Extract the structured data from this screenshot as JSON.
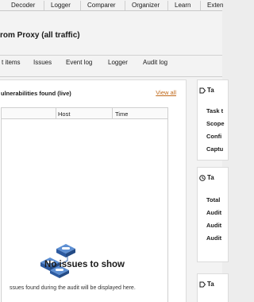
{
  "top_tabs": [
    "Decoder",
    "Logger",
    "Comparer",
    "Organizer",
    "Learn",
    "Exten"
  ],
  "task_title": "rom Proxy (all traffic)",
  "sub_tabs": [
    "t items",
    "Issues",
    "Event log",
    "Logger",
    "Audit log"
  ],
  "panel": {
    "title": "ulnerabilities found (live)",
    "view_all": "View all",
    "columns": [
      "",
      "Host",
      "Time"
    ],
    "empty_title": "No issues to show",
    "empty_desc": "ssues found during the audit will be displayed here."
  },
  "side": {
    "card1": {
      "heading": "Ta",
      "icon": "tag-icon",
      "rows": [
        "Task t",
        "Scope",
        "Confi",
        "Captu"
      ]
    },
    "card2": {
      "heading": "Ta",
      "icon": "clock-icon",
      "rows": [
        "Total",
        "Audit",
        "Audit",
        "Audit"
      ]
    },
    "card3": {
      "heading": "Ta",
      "icon": "tag-icon"
    }
  },
  "colors": {
    "link": "#c06a1c",
    "illustration": "#3d6fb6"
  }
}
